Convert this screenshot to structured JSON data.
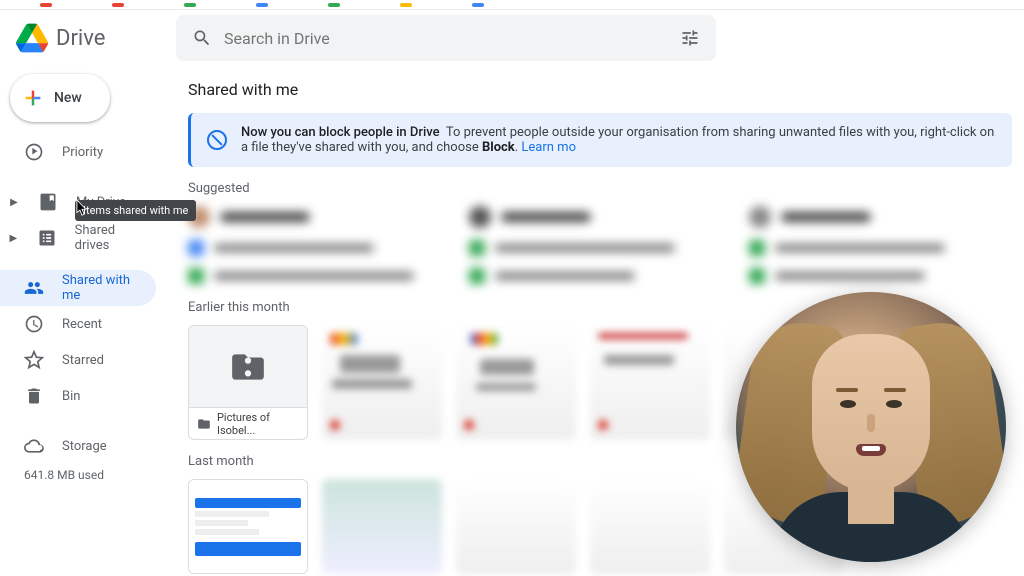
{
  "header": {
    "product": "Drive",
    "search_placeholder": "Search in Drive"
  },
  "sidebar": {
    "new_label": "New",
    "items": [
      {
        "label": "Priority",
        "icon": "priority"
      },
      {
        "label": "My Drive",
        "icon": "mydrive"
      },
      {
        "label": "Shared drives",
        "icon": "shareddrives"
      },
      {
        "label": "Shared with me",
        "icon": "sharedwithme"
      },
      {
        "label": "Recent",
        "icon": "recent"
      },
      {
        "label": "Starred",
        "icon": "starred"
      },
      {
        "label": "Bin",
        "icon": "bin"
      },
      {
        "label": "Storage",
        "icon": "storage"
      }
    ],
    "storage_used": "641.8 MB used",
    "tooltip": "Items shared with me"
  },
  "main": {
    "title": "Shared with me",
    "banner": {
      "headline": "Now you can block people in Drive",
      "body_pre": "To prevent people outside your organisation from sharing unwanted files with you, right-click on a file they've shared with you, and choose ",
      "bold": "Block",
      "body_post": ". ",
      "link": "Learn mo"
    },
    "sections": {
      "suggested": "Suggested",
      "earlier": "Earlier this month",
      "lastmonth": "Last month"
    },
    "files": {
      "folder_name": "Pictures of Isobel..."
    }
  }
}
